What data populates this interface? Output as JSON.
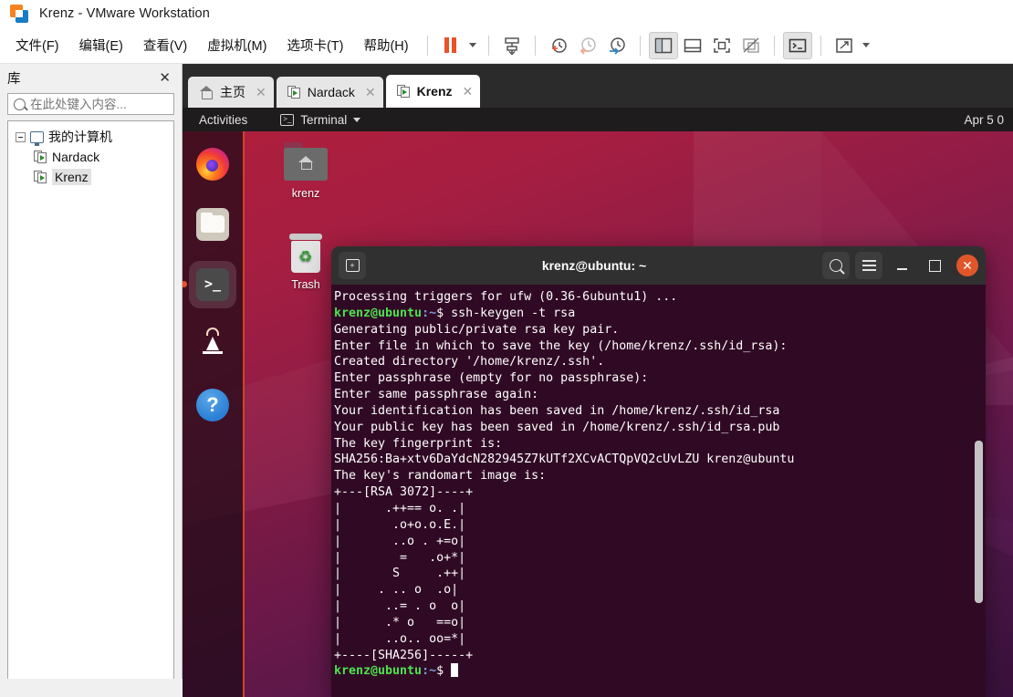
{
  "window": {
    "title": "Krenz - VMware Workstation",
    "logo_name": "vmware-logo"
  },
  "menubar": {
    "items": [
      {
        "label": "文件(F)",
        "name": "menu-file"
      },
      {
        "label": "编辑(E)",
        "name": "menu-edit"
      },
      {
        "label": "查看(V)",
        "name": "menu-view"
      },
      {
        "label": "虚拟机(M)",
        "name": "menu-vm"
      },
      {
        "label": "选项卡(T)",
        "name": "menu-tabs"
      },
      {
        "label": "帮助(H)",
        "name": "menu-help"
      }
    ],
    "toolbar": [
      {
        "name": "pause-vm-button",
        "icon": "pause-icon"
      },
      {
        "name": "pause-dropdown-caret",
        "icon": "chevron-down-icon"
      },
      {
        "name": "snapshot-button",
        "icon": "snapshot-icon"
      },
      {
        "name": "take-snapshot-button",
        "icon": "clock-plus-icon"
      },
      {
        "name": "revert-snapshot-button",
        "icon": "clock-back-icon"
      },
      {
        "name": "snapshot-manager-button",
        "icon": "clock-wrench-icon"
      },
      {
        "name": "show-library-button",
        "icon": "sidebar-panel-icon"
      },
      {
        "name": "show-thumbnail-bar-button",
        "icon": "bottom-panel-icon"
      },
      {
        "name": "full-screen-button",
        "icon": "fullscreen-icon"
      },
      {
        "name": "unity-mode-button",
        "icon": "unity-mode-icon"
      },
      {
        "name": "console-view-button",
        "icon": "console-icon"
      },
      {
        "name": "stretch-guest-button",
        "icon": "expand-arrows-icon"
      },
      {
        "name": "stretch-dropdown-caret",
        "icon": "chevron-down-icon"
      }
    ]
  },
  "library": {
    "title": "库",
    "close_label": "✕",
    "search_placeholder": "在此处键入内容...",
    "search_value": "",
    "tree": {
      "root_label": "我的计算机",
      "items": [
        {
          "label": "Nardack",
          "selected": false
        },
        {
          "label": "Krenz",
          "selected": true
        }
      ]
    }
  },
  "tabs": [
    {
      "label": "主页",
      "icon": "home-icon",
      "active": false,
      "close": "✕"
    },
    {
      "label": "Nardack",
      "icon": "vm-icon",
      "active": false,
      "close": "✕"
    },
    {
      "label": "Krenz",
      "icon": "vm-icon",
      "active": true,
      "close": "✕"
    }
  ],
  "guest": {
    "topbar": {
      "activities": "Activities",
      "app_name": "Terminal",
      "app_icon": "terminal-icon",
      "clock": "Apr 5 0"
    },
    "dock": [
      {
        "name": "dock-firefox",
        "label": "Firefox",
        "running": false
      },
      {
        "name": "dock-files",
        "label": "Files",
        "running": false
      },
      {
        "name": "dock-terminal",
        "label": "Terminal",
        "running": true
      },
      {
        "name": "dock-software",
        "label": "Ubuntu Software",
        "running": false
      },
      {
        "name": "dock-help",
        "label": "Help",
        "running": false
      }
    ],
    "desktop_icons": [
      {
        "name": "desktop-icon-home",
        "label": "krenz",
        "glyph": "home-folder-icon"
      },
      {
        "name": "desktop-icon-trash",
        "label": "Trash",
        "glyph": "trash-icon"
      }
    ],
    "terminal": {
      "title": "krenz@ubuntu: ~",
      "new_tab_icon": "new-tab-icon",
      "search_icon": "search-icon",
      "menu_icon": "hamburger-menu-icon",
      "minimize_icon": "minimize-icon",
      "maximize_icon": "maximize-icon",
      "close_icon": "close-icon",
      "prompt": {
        "user": "krenz@ubuntu",
        "path": ":~",
        "symbol": "$"
      },
      "lines": [
        {
          "type": "plain",
          "text": "Processing triggers for ufw (0.36-6ubuntu1) ..."
        },
        {
          "type": "prompt",
          "command": " ssh-keygen -t rsa"
        },
        {
          "type": "plain",
          "text": "Generating public/private rsa key pair."
        },
        {
          "type": "plain",
          "text": "Enter file in which to save the key (/home/krenz/.ssh/id_rsa):"
        },
        {
          "type": "plain",
          "text": "Created directory '/home/krenz/.ssh'."
        },
        {
          "type": "plain",
          "text": "Enter passphrase (empty for no passphrase):"
        },
        {
          "type": "plain",
          "text": "Enter same passphrase again:"
        },
        {
          "type": "plain",
          "text": "Your identification has been saved in /home/krenz/.ssh/id_rsa"
        },
        {
          "type": "plain",
          "text": "Your public key has been saved in /home/krenz/.ssh/id_rsa.pub"
        },
        {
          "type": "plain",
          "text": "The key fingerprint is:"
        },
        {
          "type": "plain",
          "text": "SHA256:Ba+xtv6DaYdcN282945Z7kUTf2XCvACTQpVQ2cUvLZU krenz@ubuntu"
        },
        {
          "type": "plain",
          "text": "The key's randomart image is:"
        },
        {
          "type": "plain",
          "text": "+---[RSA 3072]----+"
        },
        {
          "type": "plain",
          "text": "|      .++== o. .|"
        },
        {
          "type": "plain",
          "text": "|       .o+o.o.E.|"
        },
        {
          "type": "plain",
          "text": "|       ..o . +=o|"
        },
        {
          "type": "plain",
          "text": "|        =   .o+*|"
        },
        {
          "type": "plain",
          "text": "|       S     .++|"
        },
        {
          "type": "plain",
          "text": "|     . .. o  .o|"
        },
        {
          "type": "plain",
          "text": "|      ..= . o  o|"
        },
        {
          "type": "plain",
          "text": "|      .* o   ==o|"
        },
        {
          "type": "plain",
          "text": "|      ..o.. oo=*|"
        },
        {
          "type": "plain",
          "text": "+----[SHA256]-----+"
        },
        {
          "type": "prompt",
          "command": ""
        }
      ]
    }
  },
  "colors": {
    "vmware_orange": "#e8532a",
    "terminal_bg": "#300a24",
    "prompt_green": "#4ee24e",
    "prompt_blue": "#7c9ddb",
    "ubuntu_close": "#e0562a"
  }
}
